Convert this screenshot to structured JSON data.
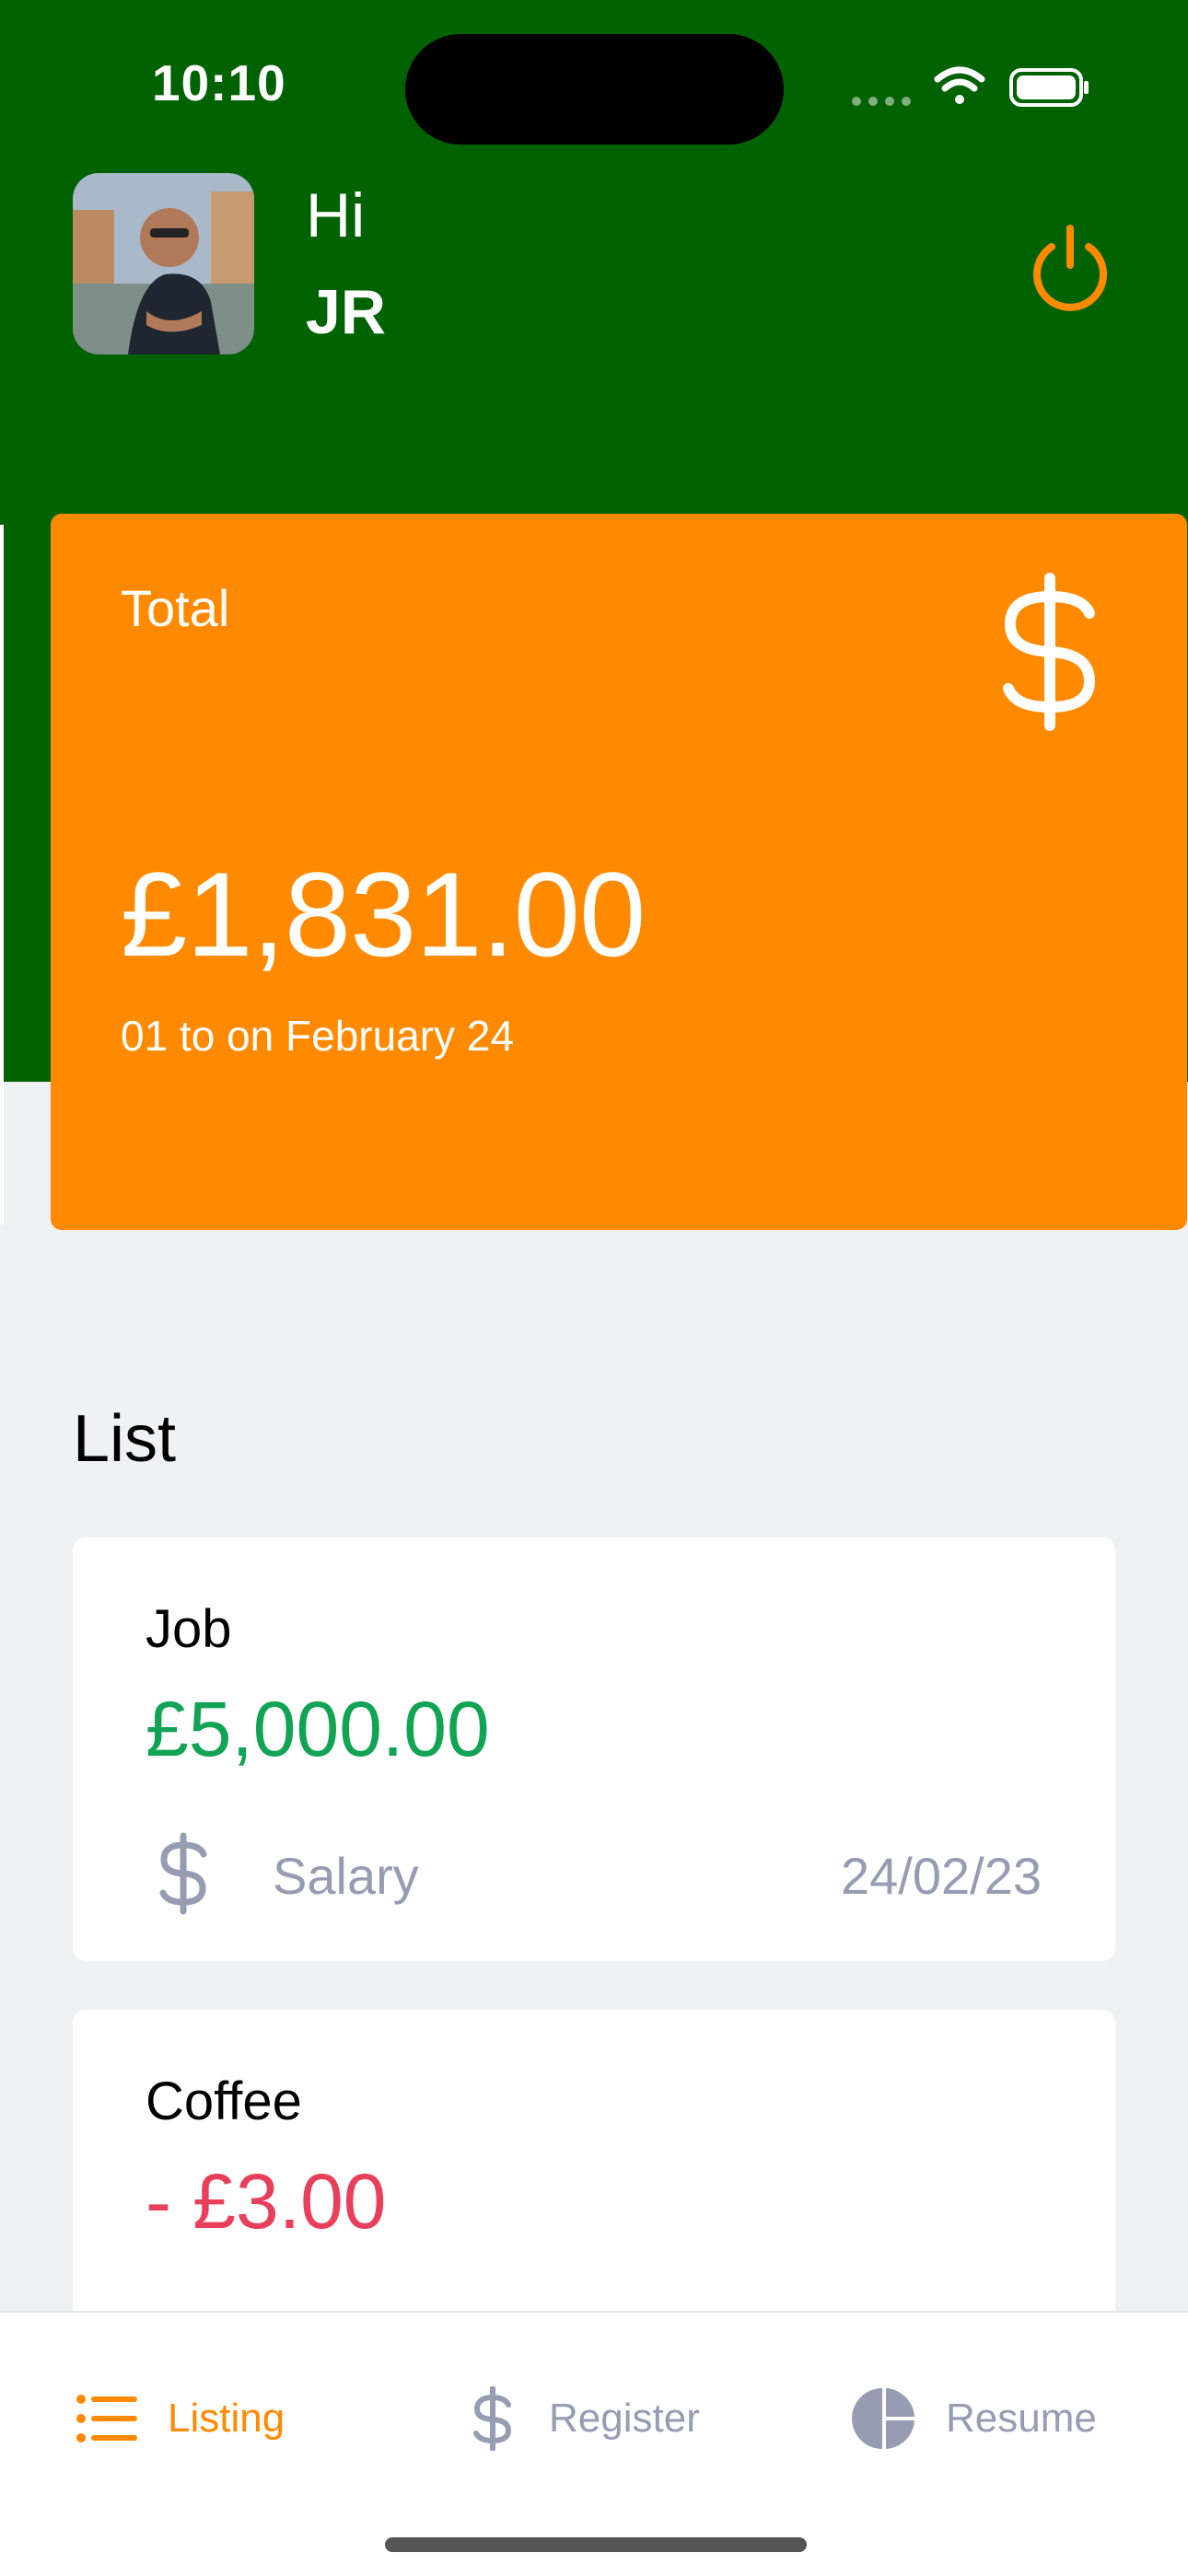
{
  "status_bar": {
    "time": "10:10"
  },
  "header": {
    "greeting": "Hi",
    "user_name": "JR",
    "colors": {
      "background": "#016201",
      "power_icon": "#ff8a00"
    },
    "icons": {
      "power": "power-icon"
    }
  },
  "summary_card": {
    "label": "Total",
    "amount": "£1,831.00",
    "period": "01 to on February 24",
    "icon": "dollar-icon",
    "color": "#ff8a00"
  },
  "list": {
    "title": "List",
    "items": [
      {
        "title": "Job",
        "amount": "£5,000.00",
        "type": "income",
        "category": "Salary",
        "category_icon": "dollar-icon",
        "date": "24/02/23"
      },
      {
        "title": "Coffee",
        "amount": "- £3.00",
        "type": "outcome",
        "category": "",
        "date": ""
      }
    ],
    "colors": {
      "income": "#12a454",
      "outcome": "#e83f5b",
      "muted": "#969cb2"
    }
  },
  "tabbar": {
    "tabs": [
      {
        "label": "Listing",
        "icon": "list-icon",
        "active": true
      },
      {
        "label": "Register",
        "icon": "dollar-icon",
        "active": false
      },
      {
        "label": "Resume",
        "icon": "pie-chart-icon",
        "active": false
      }
    ],
    "colors": {
      "active": "#ff8a00",
      "inactive": "#969cb2"
    }
  }
}
